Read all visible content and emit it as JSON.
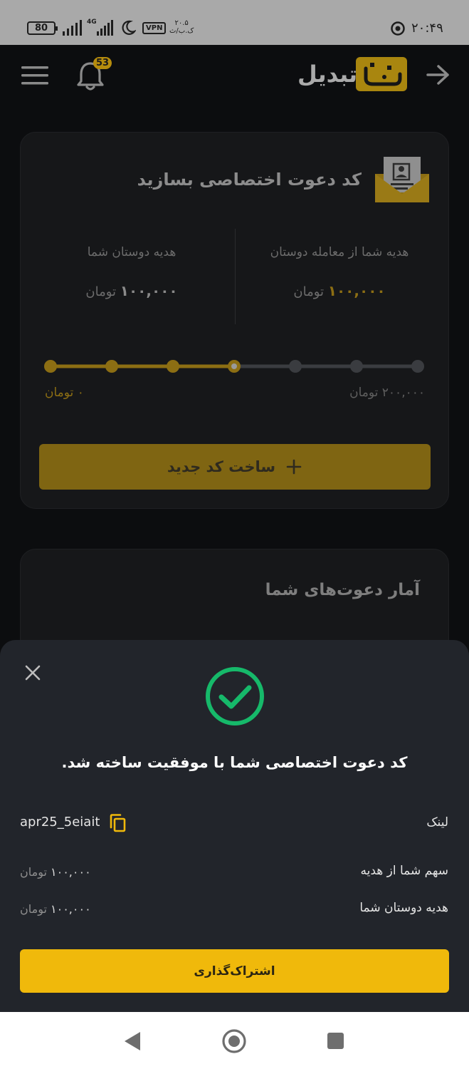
{
  "status_bar": {
    "battery": "80",
    "network": "4G",
    "vpn": "VPN",
    "speed_value": "۲۰.۵",
    "speed_unit": "ک.ب/ث",
    "time": "۲۰:۴۹"
  },
  "header": {
    "app_name": "تبدیل",
    "notification_count": "53"
  },
  "invite_card": {
    "title": "کد دعوت اختصاصی بسازید",
    "your_gift_label": "هدیه شما از معامله دوستان",
    "your_gift_amount": "۱۰۰,۰۰۰",
    "friends_gift_label": "هدیه دوستان شما",
    "friends_gift_amount": "۱۰۰,۰۰۰",
    "currency": "تومان",
    "progress_min_label": "۰ تومان",
    "progress_max_label": "۲۰۰,۰۰۰ تومان",
    "progress_fraction": 0.5,
    "progress_steps": 7,
    "new_code_label": "ساخت کد جدید"
  },
  "stats_card": {
    "title": "آمار دعوت‌های شما"
  },
  "sheet": {
    "title": "کد دعوت اختصاصی شما با موفقیت ساخته شد.",
    "link_label": "لینک",
    "code": "apr25_5eiait",
    "share_label": "سهم شما از هدیه",
    "share_amount": "۱۰۰,۰۰۰",
    "friends_label": "هدیه دوستان شما",
    "friends_amount": "۱۰۰,۰۰۰",
    "currency": "تومان",
    "share_button": "اشتراک‌گذاری"
  },
  "colors": {
    "accent": "#f0b90b",
    "success": "#16b96a",
    "background": "#0c0d0f",
    "sheet": "#22252b"
  },
  "icons": [
    "menu-icon",
    "bell-icon",
    "back-arrow-icon",
    "envelope-icon",
    "plus-icon",
    "close-icon",
    "check-circle-icon",
    "copy-icon",
    "nav-back-icon",
    "nav-home-icon",
    "nav-recents-icon"
  ]
}
